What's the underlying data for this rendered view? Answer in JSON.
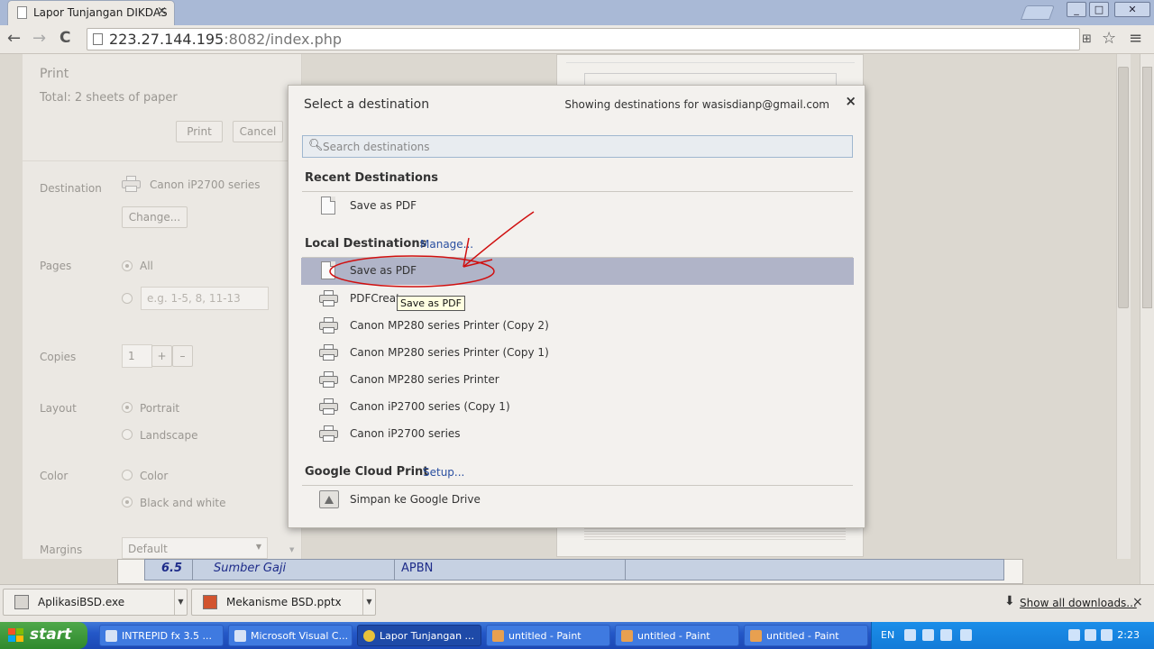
{
  "browser": {
    "tab_title": "Lapor Tunjangan DIKDAS",
    "tab_close": "×",
    "url_host": "223.27.144.195",
    "url_path": ":8082/index.php",
    "nav_back": "←",
    "nav_forward": "→",
    "nav_reload": "C",
    "star": "☆",
    "menu": "≡",
    "win_min": "_",
    "win_max": "□",
    "win_close": "✕"
  },
  "print_panel": {
    "heading": "Print",
    "total": "Total: 2 sheets of paper",
    "print_button": "Print",
    "cancel_button": "Cancel",
    "destination_label": "Destination",
    "destination_value": "Canon iP2700 series",
    "change_button": "Change...",
    "pages_label": "Pages",
    "pages_all": "All",
    "pages_placeholder": "e.g. 1-5, 8, 11-13",
    "copies_label": "Copies",
    "copies_value": "1",
    "plus": "+",
    "minus": "–",
    "layout_label": "Layout",
    "layout_portrait": "Portrait",
    "layout_landscape": "Landscape",
    "color_label": "Color",
    "color_color": "Color",
    "color_bw": "Black and white",
    "margins_label": "Margins",
    "margins_value": "Default"
  },
  "dialog": {
    "title": "Select a destination",
    "showing": "Showing destinations for wasisdianp@gmail.com",
    "close": "×",
    "search_placeholder": "Search destinations",
    "recent_header": "Recent Destinations",
    "recent_items": [
      "Save as PDF"
    ],
    "local_header": "Local Destinations",
    "manage_link": "Manage...",
    "local_items": [
      "Save as PDF",
      "PDFCreat",
      "Canon MP280 series Printer (Copy 2)",
      "Canon MP280 series Printer (Copy 1)",
      "Canon MP280 series Printer",
      "Canon iP2700 series (Copy 1)",
      "Canon iP2700 series"
    ],
    "tooltip": "Save as PDF",
    "cloud_header": "Google Cloud Print",
    "setup_link": "Setup...",
    "cloud_items": [
      "Simpan ke Google Drive"
    ]
  },
  "page_row": {
    "num": "6.5",
    "name": "Sumber Gaji",
    "value": "APBN"
  },
  "downloads": {
    "items": [
      "AplikasiBSD.exe",
      "Mekanisme BSD.pptx"
    ],
    "show_all": "Show all downloads...",
    "close": "×"
  },
  "taskbar": {
    "start": "start",
    "items": [
      "INTREPID fx 3.5 ...",
      "Microsoft Visual C...",
      "Lapor Tunjangan ...",
      "untitled - Paint",
      "untitled - Paint",
      "untitled - Paint"
    ],
    "lang": "EN",
    "clock": "2:23"
  },
  "colors": {
    "selected_row": "#b0b4c8",
    "annotation": "#d01010",
    "taskbar": "#2458c8",
    "start": "#3a9a36"
  }
}
